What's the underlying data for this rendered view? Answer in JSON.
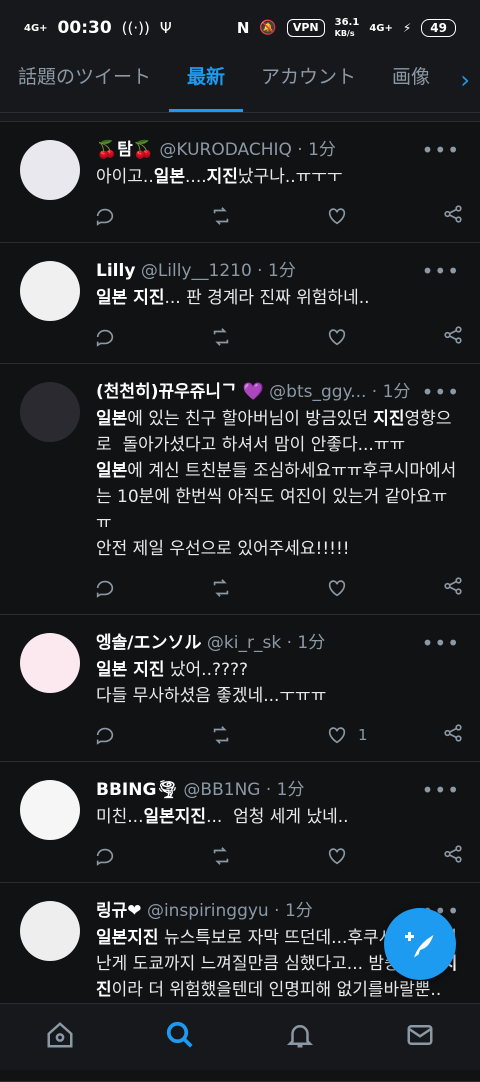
{
  "status": {
    "network": "4G+",
    "time": "00:30",
    "vpn": "VPN",
    "speed": "36.1",
    "speed_unit": "KB/s",
    "net2": "4G+",
    "battery": "49"
  },
  "tabs": [
    "話題のツイート",
    "最新",
    "アカウント",
    "画像"
  ],
  "tweets": [
    {
      "name": "🍒탐🍒",
      "handle": "@KURODACHIQ",
      "time": "1分",
      "body": [
        {
          "t": "아이고.."
        },
        {
          "t": "일본",
          "b": true
        },
        {
          "t": "...."
        },
        {
          "t": "지진",
          "b": true
        },
        {
          "t": "났구나..ㅠㅜㅜ"
        }
      ],
      "likes": ""
    },
    {
      "name": "Lilly",
      "handle": "@Lilly__1210",
      "time": "1分",
      "body": [
        {
          "t": "일본 지진",
          "b": true
        },
        {
          "t": "... 판 경계라 진짜 위험하네.."
        }
      ],
      "likes": ""
    },
    {
      "name": "(천천히)뀨우쥬니ᄀ 💜",
      "handle": "@bts_ggy...",
      "time": "1分",
      "body": [
        {
          "t": "일본",
          "b": true
        },
        {
          "t": "에 있는 친구 할아버님이 방금있던 "
        },
        {
          "t": "지진",
          "b": true
        },
        {
          "t": "영향으로  돌아가셨다고 하셔서 맘이 안좋다...ㅠㅠ\n"
        },
        {
          "t": "일본",
          "b": true
        },
        {
          "t": "에 계신 트친분들 조심하세요ㅠㅠ후쿠시마에서는 10분에 한번씩 아직도 여진이 있는거 같아요ㅠㅠ\n안전 제일 우선으로 있어주세요!!!!!"
        }
      ],
      "likes": ""
    },
    {
      "name": "엥솔/エンソル",
      "handle": "@ki_r_sk",
      "time": "1分",
      "body": [
        {
          "t": "일본 지진",
          "b": true
        },
        {
          "t": " 났어..????\n다들 무사하셨음 좋겠네...ㅜㅠㅠ"
        }
      ],
      "likes": "1"
    },
    {
      "name": "BBING🌪",
      "handle": "@BB1NG",
      "time": "1分",
      "body": [
        {
          "t": "미친..."
        },
        {
          "t": "일본지진",
          "b": true
        },
        {
          "t": "...  엄청 세게 났네.."
        }
      ],
      "likes": ""
    },
    {
      "name": "링규❤",
      "handle": "@inspiringgyu",
      "time": "1分",
      "body": [
        {
          "t": "일본지진",
          "b": true
        },
        {
          "t": " 뉴스특보로 자막 뜨던데...후쿠시마쪽에서 난게 도쿄까지 느껴질만큼 심했다고... 밤중에 난 "
        },
        {
          "t": "지진",
          "b": true
        },
        {
          "t": "이라 더 위험했을텐데 인명피해 없기를바랄뿐..🙏🏻자연재해가 진짜 제일 무섭다 같아"
        }
      ],
      "likes": ""
    }
  ]
}
